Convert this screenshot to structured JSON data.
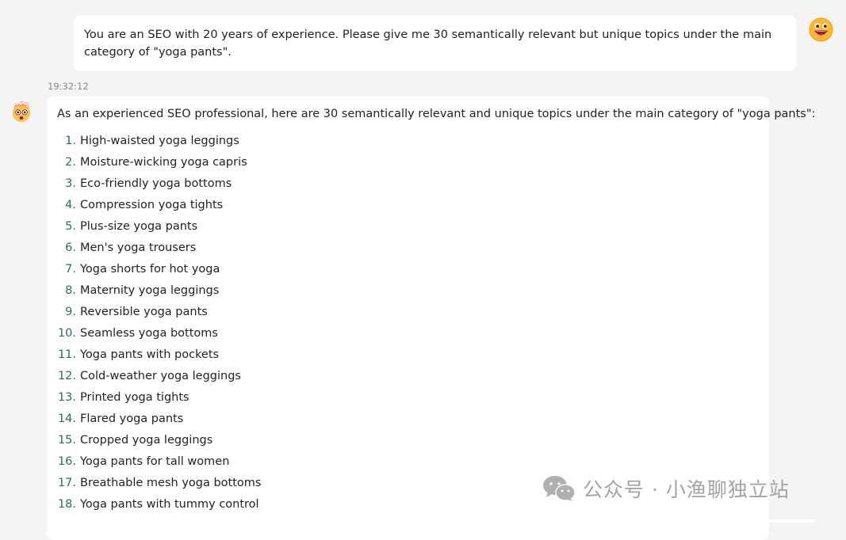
{
  "user_message": {
    "text": "You are an SEO with 20 years of experience. Please give me 30 semantically relevant but unique topics under the main category of \"yoga pants\"."
  },
  "timestamp": "19:32:12",
  "bot_message": {
    "intro": "As an experienced SEO professional, here are 30 semantically relevant and unique topics under the main category of \"yoga pants\":",
    "topics": [
      {
        "num": "1.",
        "text": "High-waisted yoga leggings"
      },
      {
        "num": "2.",
        "text": "Moisture-wicking yoga capris"
      },
      {
        "num": "3.",
        "text": "Eco-friendly yoga bottoms"
      },
      {
        "num": "4.",
        "text": "Compression yoga tights"
      },
      {
        "num": "5.",
        "text": "Plus-size yoga pants"
      },
      {
        "num": "6.",
        "text": "Men's yoga trousers"
      },
      {
        "num": "7.",
        "text": "Yoga shorts for hot yoga"
      },
      {
        "num": "8.",
        "text": "Maternity yoga leggings"
      },
      {
        "num": "9.",
        "text": "Reversible yoga pants"
      },
      {
        "num": "10.",
        "text": "Seamless yoga bottoms"
      },
      {
        "num": "11.",
        "text": "Yoga pants with pockets"
      },
      {
        "num": "12.",
        "text": "Cold-weather yoga leggings"
      },
      {
        "num": "13.",
        "text": "Printed yoga tights"
      },
      {
        "num": "14.",
        "text": "Flared yoga pants"
      },
      {
        "num": "15.",
        "text": "Cropped yoga leggings"
      },
      {
        "num": "16.",
        "text": "Yoga pants for tall women"
      },
      {
        "num": "17.",
        "text": "Breathable mesh yoga bottoms"
      },
      {
        "num": "18.",
        "text": "Yoga pants with tummy control"
      }
    ]
  },
  "watermark": {
    "text": "公众号 · 小渔聊独立站",
    "icon": "wechat-icon"
  },
  "avatars": {
    "user": "grinning-face-icon",
    "bot": "exploding-head-icon"
  },
  "colors": {
    "background": "#f4f4f4",
    "bubble": "#ffffff",
    "list_number": "#2a6e5f",
    "timestamp": "#8a8a8a",
    "watermark": "#9a9a9a"
  }
}
